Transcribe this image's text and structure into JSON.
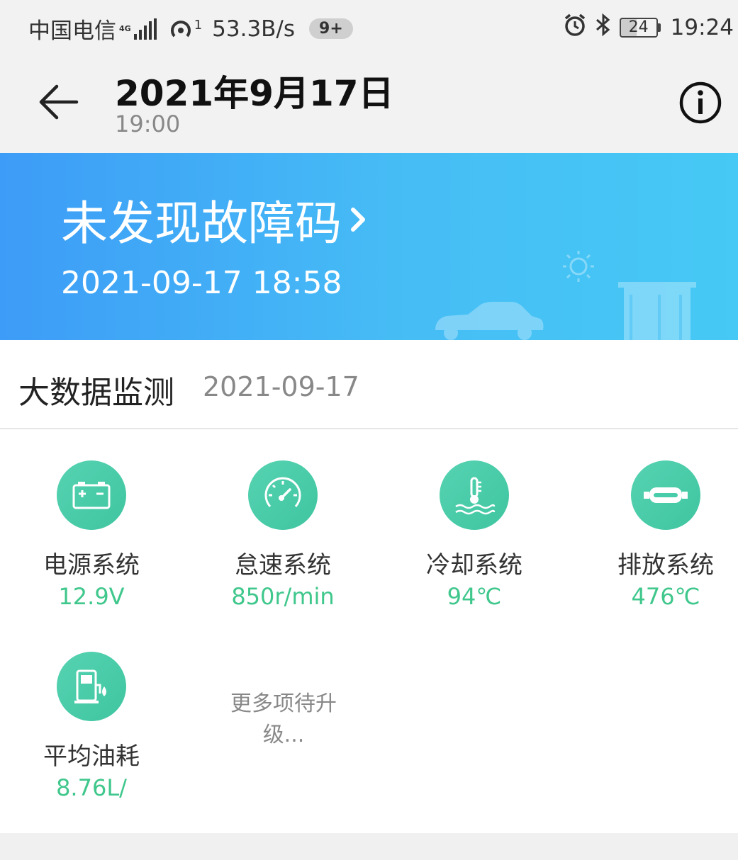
{
  "status_bar": {
    "carrier": "中国电信",
    "network_type": "4G",
    "hotspot_count": "1",
    "net_speed": "53.3B/s",
    "notification_badge": "9+",
    "battery": "24",
    "time": "19:24"
  },
  "app_bar": {
    "title": "2021年9月17日",
    "subtitle": "19:00"
  },
  "banner": {
    "headline": "未发现故障码",
    "timestamp": "2021-09-17 18:58"
  },
  "section": {
    "title": "大数据监测",
    "date": "2021-09-17"
  },
  "metrics": [
    {
      "name": "电源系统",
      "value": "12.9V",
      "icon": "battery-icon"
    },
    {
      "name": "怠速系统",
      "value": "850r/min",
      "icon": "speedometer-icon"
    },
    {
      "name": "冷却系统",
      "value": "94℃",
      "icon": "coolant-temperature-icon"
    },
    {
      "name": "排放系统",
      "value": "476℃",
      "icon": "exhaust-icon"
    },
    {
      "name": "平均油耗",
      "value": "8.76L/",
      "icon": "fuel-pump-icon"
    }
  ],
  "more_text": "更多项待升级...",
  "colors": {
    "banner_start": "#3d9cf7",
    "banner_end": "#46c9f5",
    "icon_circle": "#49cca9",
    "value_green": "#3fc78c"
  }
}
